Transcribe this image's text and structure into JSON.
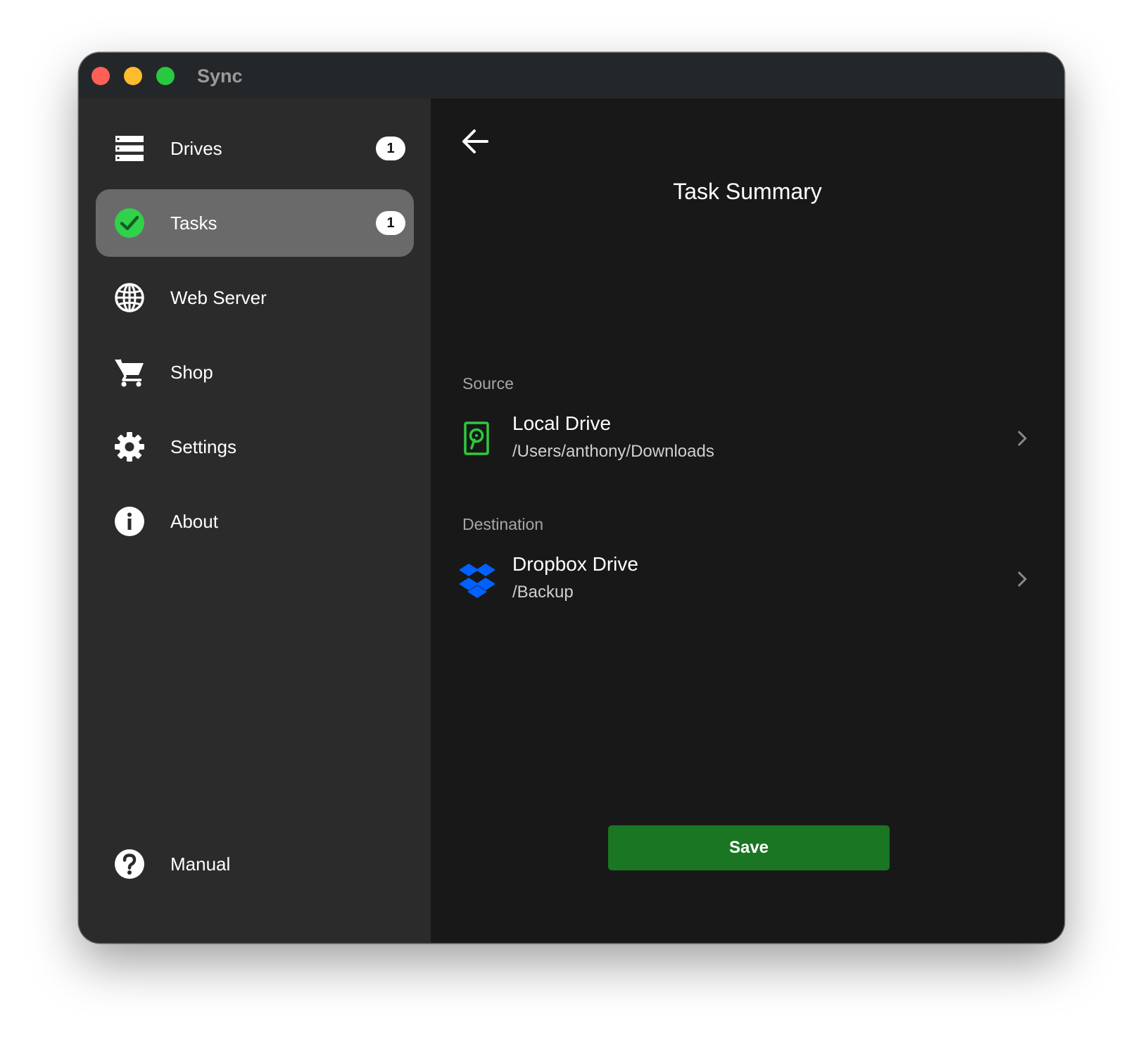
{
  "window": {
    "title": "Sync"
  },
  "sidebar": {
    "items": [
      {
        "label": "Drives",
        "icon": "drives-list-icon",
        "badge": "1",
        "selected": false
      },
      {
        "label": "Tasks",
        "icon": "check-circle-icon",
        "badge": "1",
        "selected": true
      },
      {
        "label": "Web Server",
        "icon": "globe-icon",
        "badge": null,
        "selected": false
      },
      {
        "label": "Shop",
        "icon": "cart-icon",
        "badge": null,
        "selected": false
      },
      {
        "label": "Settings",
        "icon": "gear-icon",
        "badge": null,
        "selected": false
      },
      {
        "label": "About",
        "icon": "info-icon",
        "badge": null,
        "selected": false
      }
    ],
    "footer_item": {
      "label": "Manual",
      "icon": "help-icon"
    }
  },
  "main": {
    "back_icon": "arrow-left-icon",
    "title": "Task Summary",
    "source": {
      "section_label": "Source",
      "name": "Local Drive",
      "path": "/Users/anthony/Downloads",
      "icon": "hard-drive-icon"
    },
    "destination": {
      "section_label": "Destination",
      "name": "Dropbox Drive",
      "path": "/Backup",
      "icon": "dropbox-icon"
    },
    "save_label": "Save"
  },
  "colors": {
    "sidebar_bg": "#2b2b2b",
    "main_bg": "#181818",
    "selected_bg": "#6a6a6a",
    "accent_green": "#1a7623",
    "check_green": "#2fd24a",
    "dropbox_blue": "#0061fe"
  }
}
